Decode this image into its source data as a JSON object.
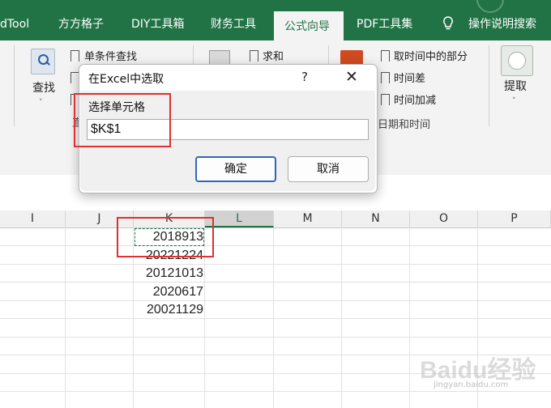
{
  "ribbon_tabs": [
    "dTool",
    "方方格子",
    "DIY工具箱",
    "财务工具",
    "公式向导",
    "PDF工具集"
  ],
  "active_tab": "公式向导",
  "help_search": "操作说明搜索",
  "ribbon": {
    "search_label": "查找",
    "single_condition_lookup": "单条件查找",
    "sum_label": "求和",
    "time_part": "取时间中的部分",
    "time_diff": "时间差",
    "time_add": "时间加减",
    "date_group": "日期和时间",
    "extract_label": "提取",
    "partial_char": "直"
  },
  "columns": [
    "I",
    "J",
    "K",
    "L",
    "M",
    "N",
    "O",
    "P"
  ],
  "selected_column": "L",
  "cells_k": [
    "2018913",
    "20221224",
    "20121013",
    "2020617",
    "20021129"
  ],
  "dialog": {
    "title": "在Excel中选取",
    "help": "?",
    "close": "✕",
    "label": "选择单元格",
    "value": "$K$1",
    "ok": "确定",
    "cancel": "取消"
  },
  "watermark": {
    "main": "Baidu经验",
    "sub": "jingyan.baidu.com"
  },
  "colors": {
    "excel_green": "#217346",
    "highlight_red": "#e0302f",
    "primary_blue": "#2b68b8"
  }
}
